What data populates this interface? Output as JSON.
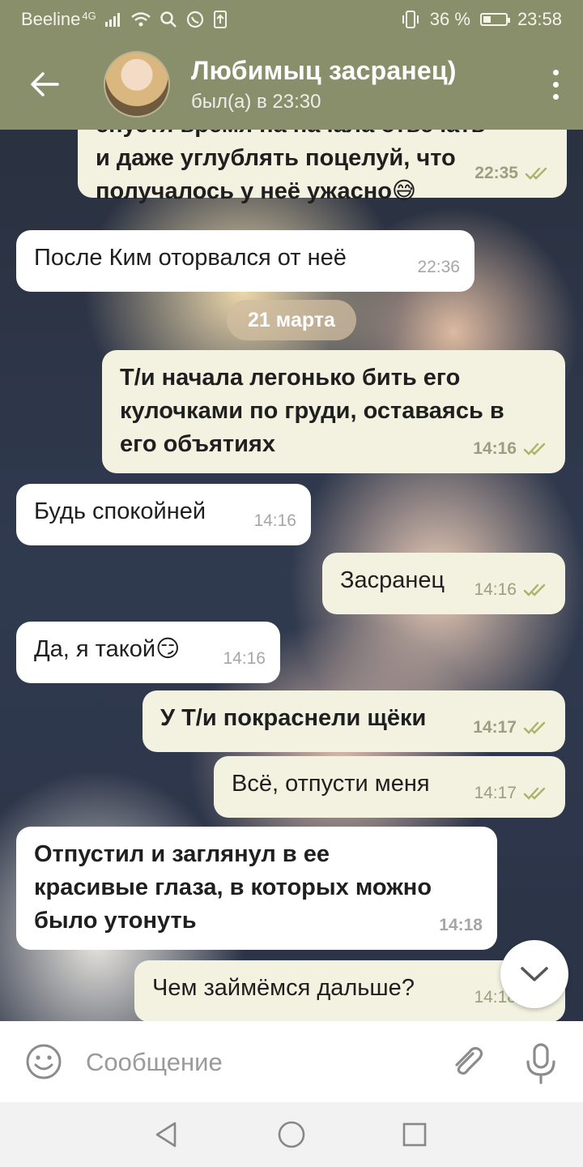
{
  "status_bar": {
    "carrier": "Beeline",
    "network": "4G",
    "battery_percent": "36 %",
    "battery_level": 0.36,
    "time": "23:58"
  },
  "header": {
    "title": "Любимыц засранец)",
    "subtitle": "был(а) в 23:30"
  },
  "messages": [
    {
      "dir": "out",
      "text": "спустя время на начала отвечать\nи даже углублять поцелуй, что\nполучалось у неё ужасно😅",
      "time": "22:35",
      "read": true
    },
    {
      "dir": "in",
      "text": "После Ким оторвался от неё",
      "time": "22:36"
    },
    {
      "dir": "out",
      "text": "Т/и начала легонько бить его\nкулочками по груди, оставаясь в\nего объятиях",
      "time": "14:16",
      "read": true
    },
    {
      "dir": "in",
      "text": "Будь спокойней",
      "time": "14:16"
    },
    {
      "dir": "out",
      "text": "Засранец",
      "time": "14:16",
      "read": true
    },
    {
      "dir": "in",
      "text": "Да, я такой😏",
      "time": "14:16"
    },
    {
      "dir": "out",
      "text": "У Т/и покраснели щёки",
      "time": "14:17",
      "read": true
    },
    {
      "dir": "out",
      "text": "Всё, отпусти меня",
      "time": "14:17",
      "read": true
    },
    {
      "dir": "in",
      "text": "Отпустил и заглянул в ее\nкрасивые глаза, в которых можно\nбыло утонуть",
      "time": "14:18"
    },
    {
      "dir": "out",
      "text": "Чем займёмся дальше?",
      "time": "14:18",
      "read": true
    }
  ],
  "date_separator": "21 марта",
  "composer": {
    "placeholder": "Сообщение"
  },
  "icons": {
    "back": "arrow-left-icon",
    "menu": "more-vertical-icon",
    "emoji": "smiley-icon",
    "attach": "paperclip-icon",
    "mic": "microphone-icon",
    "scroll": "chevron-down-icon"
  },
  "colors": {
    "header_bg": "#8a8f6b",
    "outgoing_bubble": "#f3f1e0",
    "incoming_bubble": "#ffffff",
    "tick_color": "#a9b36a"
  }
}
